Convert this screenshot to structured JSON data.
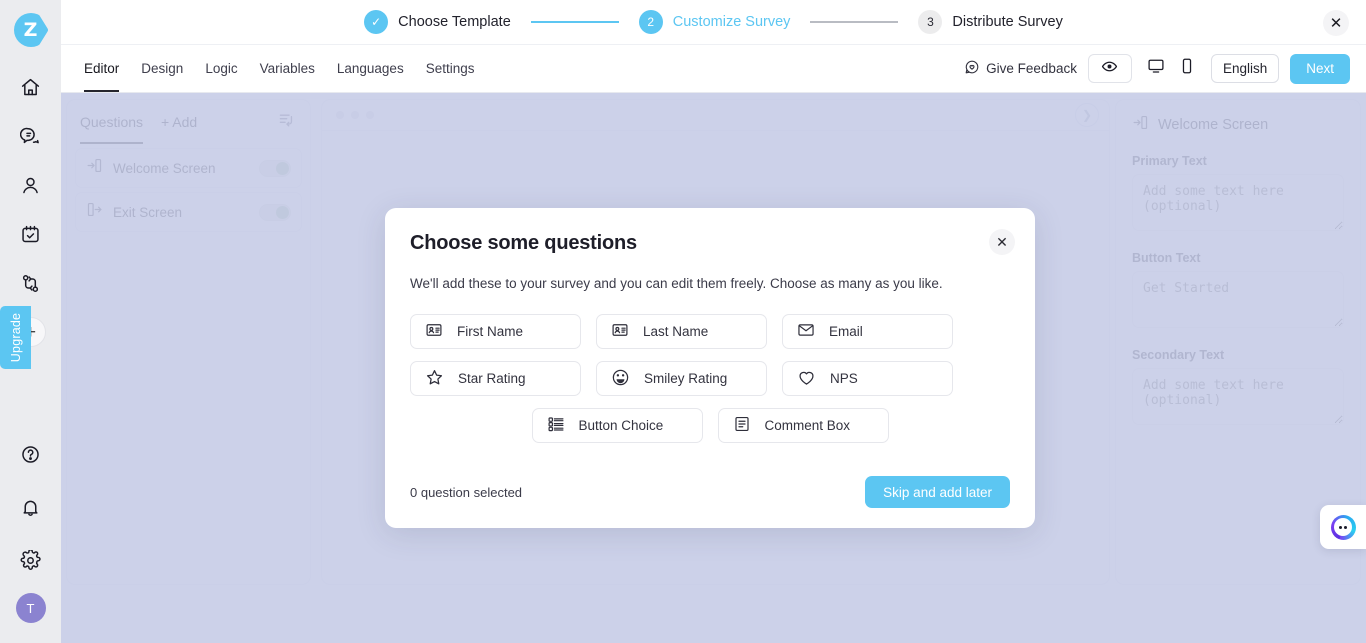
{
  "brand": {
    "logo_letter": "Z",
    "accent": "#5cc6f2"
  },
  "rail": {
    "items": [
      {
        "name": "home-icon",
        "label": "Home"
      },
      {
        "name": "chat-icon",
        "label": "Inbox"
      },
      {
        "name": "user-icon",
        "label": "Contacts"
      },
      {
        "name": "task-icon",
        "label": "Tasks"
      },
      {
        "name": "workflow-icon",
        "label": "Workflows"
      }
    ],
    "add_label": "+",
    "upgrade_label": "Upgrade",
    "bottom": [
      {
        "name": "help-icon",
        "label": "Help"
      },
      {
        "name": "bell-icon",
        "label": "Notifications"
      },
      {
        "name": "gear-icon",
        "label": "Settings"
      }
    ],
    "avatar_initial": "T"
  },
  "stepbar": {
    "steps": [
      {
        "marker": "✓",
        "label": "Choose Template",
        "state": "done"
      },
      {
        "marker": "2",
        "label": "Customize Survey",
        "state": "active"
      },
      {
        "marker": "3",
        "label": "Distribute Survey",
        "state": "todo"
      }
    ],
    "close_label": "✕"
  },
  "toolbar": {
    "tabs": [
      {
        "label": "Editor",
        "active": true
      },
      {
        "label": "Design",
        "active": false
      },
      {
        "label": "Logic",
        "active": false
      },
      {
        "label": "Variables",
        "active": false
      },
      {
        "label": "Languages",
        "active": false
      },
      {
        "label": "Settings",
        "active": false
      }
    ],
    "feedback_label": "Give Feedback",
    "preview_icon": "eye-icon",
    "desktop_icon": "desktop-icon",
    "mobile_icon": "mobile-icon",
    "language_label": "English",
    "next_label": "Next"
  },
  "questions_panel": {
    "title": "Questions",
    "add_label": "Add",
    "rows": [
      {
        "label": "Welcome Screen",
        "icon": "enter-screen-icon",
        "enabled": true
      },
      {
        "label": "Exit Screen",
        "icon": "exit-screen-icon",
        "enabled": true
      }
    ]
  },
  "right_panel": {
    "title": "Welcome Screen",
    "fields": [
      {
        "label": "Primary Text",
        "placeholder": "Add some text here (optional)",
        "value": ""
      },
      {
        "label": "Button Text",
        "placeholder": "Get Started",
        "value": ""
      },
      {
        "label": "Secondary Text",
        "placeholder": "Add some text here (optional)",
        "value": ""
      }
    ]
  },
  "modal": {
    "title": "Choose some questions",
    "subtitle": "We'll add these to your survey and you can edit them freely. Choose as many as you like.",
    "close_label": "✕",
    "chip_rows": [
      [
        {
          "label": "First Name",
          "icon": "contact-card-icon"
        },
        {
          "label": "Last Name",
          "icon": "contact-card-icon"
        },
        {
          "label": "Email",
          "icon": "envelope-icon"
        }
      ],
      [
        {
          "label": "Star Rating",
          "icon": "star-icon"
        },
        {
          "label": "Smiley Rating",
          "icon": "smiley-icon"
        },
        {
          "label": "NPS",
          "icon": "heart-icon"
        }
      ],
      [
        {
          "label": "Button Choice",
          "icon": "list-choice-icon"
        },
        {
          "label": "Comment Box",
          "icon": "comment-box-icon"
        }
      ]
    ],
    "selection_status": "0 question selected",
    "skip_label": "Skip and add later"
  },
  "chat_widget": {
    "name": "chat-bot-icon"
  }
}
